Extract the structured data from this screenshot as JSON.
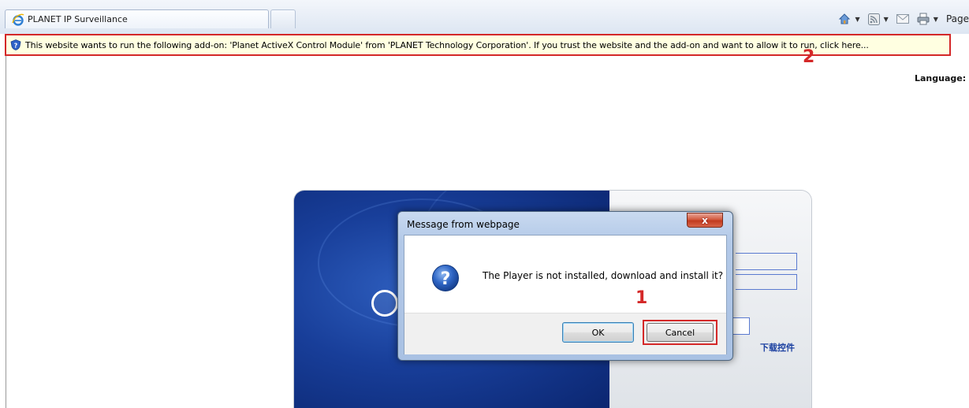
{
  "browser": {
    "tab_title": "PLANET IP Surveillance",
    "command_bar": {
      "home_icon": "home-icon",
      "feeds_icon": "feeds-icon",
      "mail_icon": "read-mail-icon",
      "print_icon": "print-icon",
      "page_label": "Page"
    }
  },
  "infobar": {
    "icon": "shield-info-icon",
    "text": "This website wants to run the following add-on: 'Planet ActiveX Control Module' from 'PLANET Technology Corporation'. If you trust the website and the add-on and want to allow it to run, click here..."
  },
  "annotations": {
    "marker_1": "1",
    "marker_2": "2",
    "color": "#d42828"
  },
  "page": {
    "language_label": "Language:",
    "download_control_link": "下载控件",
    "field_colon": ":"
  },
  "dialog": {
    "title": "Message from webpage",
    "message": "The Player is not installed, download and install it?",
    "icon": "question-icon",
    "close_symbol": "x",
    "ok_label": "OK",
    "cancel_label": "Cancel"
  }
}
